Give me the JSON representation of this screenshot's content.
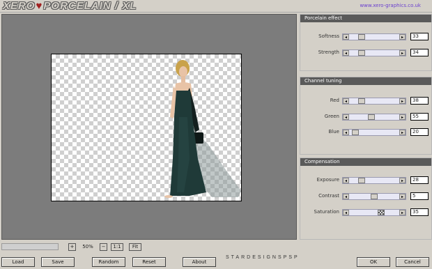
{
  "app": {
    "title_parts": [
      "XERO",
      "PORCELAIN / XL"
    ],
    "url": "www.xero-graphics.co.uk"
  },
  "sections": [
    {
      "title": "Porcelain effect",
      "controls": [
        {
          "label": "Softness",
          "value": "33"
        },
        {
          "label": "Strength",
          "value": "34"
        }
      ]
    },
    {
      "title": "Channel tuning",
      "controls": [
        {
          "label": "Red",
          "value": "38"
        },
        {
          "label": "Green",
          "value": "55"
        },
        {
          "label": "Blue",
          "value": "20"
        }
      ]
    },
    {
      "title": "Compensation",
      "controls": [
        {
          "label": "Exposure",
          "value": "28"
        },
        {
          "label": "Contrast",
          "value": "5"
        },
        {
          "label": "Saturation",
          "value": "35"
        }
      ]
    }
  ],
  "zoom": {
    "plus": "+",
    "value": "50%",
    "minus": "−",
    "one_to_one": "1:1",
    "fit": "Fit"
  },
  "brand_text": "STARDESIGNSPSP",
  "buttons": {
    "load": "Load",
    "save": "Save",
    "random": "Random",
    "reset": "Reset",
    "about": "About",
    "ok": "OK",
    "cancel": "Cancel"
  },
  "icons": {
    "arrow_left": "◂",
    "arrow_right": "▸"
  },
  "colors": {
    "panel_header": "#5a5a5a",
    "preview_bg": "#7c7c7c",
    "url_text": "#6a3fcf",
    "dress": "#1f3a38"
  }
}
